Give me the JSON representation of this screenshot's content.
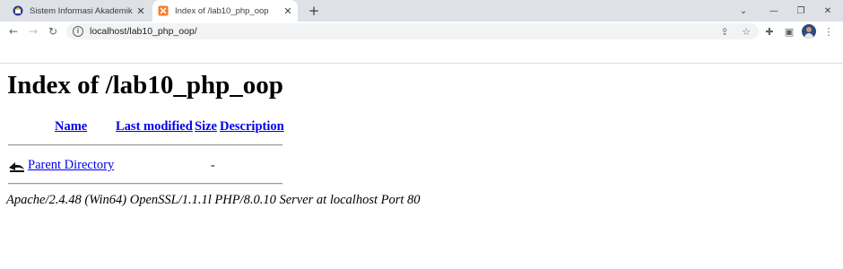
{
  "browser": {
    "tabs": [
      {
        "title": "Sistem Informasi Akademik",
        "active": false,
        "icon": "university-favicon"
      },
      {
        "title": "Index of /lab10_php_oop",
        "active": true,
        "icon": "xampp-favicon"
      }
    ],
    "new_tab_glyph": "+",
    "close_glyph": "✕",
    "window_controls": {
      "collapse": "⌄",
      "minimize": "—",
      "restore": "❐",
      "close": "✕"
    },
    "nav": {
      "back": "←",
      "forward": "→",
      "reload": "↻"
    },
    "address_bar": {
      "url": "localhost/lab10_php_oop/",
      "info_glyph": "i"
    },
    "omnibox_actions": {
      "share": "⇪",
      "bookmark": "☆"
    },
    "toolbar_icons": {
      "extensions": "✚",
      "side_panel": "▣",
      "menu": "⋮"
    }
  },
  "page": {
    "heading": "Index of /lab10_php_oop",
    "columns": {
      "name": "Name",
      "last_modified": "Last modified",
      "size": "Size",
      "description": "Description"
    },
    "rows": [
      {
        "name": "Parent Directory",
        "last_modified": "",
        "size": "-",
        "description": "",
        "icon": "back-arrow-icon"
      }
    ],
    "server_signature": "Apache/2.4.48 (Win64) OpenSSL/1.1.1l PHP/8.0.10 Server at localhost Port 80"
  }
}
